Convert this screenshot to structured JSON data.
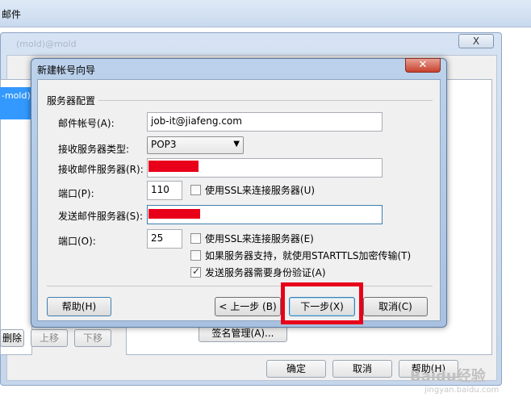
{
  "background_app": {
    "title": "邮件",
    "window_title": "(mold)@mold",
    "close_label": "X",
    "account_selected": "-mold)",
    "buttons": {
      "delete": "删除",
      "move_up": "上移",
      "move_down": "下移",
      "signature": "签名管理(A)...",
      "ok": "确定",
      "cancel": "取消",
      "help": "帮助(H)"
    }
  },
  "dialog": {
    "title": "新建帐号向导",
    "close_icon": "close-icon",
    "group_title": "服务器配置",
    "fields": {
      "email_label": "邮件帐号(A):",
      "email_value": "job-it@jiafeng.com",
      "incoming_type_label": "接收服务器类型:",
      "incoming_type_value": "POP3",
      "incoming_server_label": "接收邮件服务器(R):",
      "incoming_port_label": "端口(P):",
      "incoming_port_value": "110",
      "incoming_ssl_label": "使用SSL来连接服务器(U)",
      "outgoing_server_label": "发送邮件服务器(S):",
      "outgoing_port_label": "端口(O):",
      "outgoing_port_value": "25",
      "outgoing_ssl_label": "使用SSL来连接服务器(E)",
      "starttls_label": "如果服务器支持，就使用STARTTLS加密传输(T)",
      "auth_label": "发送服务器需要身份验证(A)"
    },
    "checkboxes": {
      "incoming_ssl": false,
      "outgoing_ssl": false,
      "starttls": false,
      "auth": true
    },
    "buttons": {
      "help": "帮助(H)",
      "back": "< 上一步 (B)",
      "next": "下一步(X)",
      "cancel": "取消(C)"
    }
  },
  "colors": {
    "highlight": "#e8001a",
    "redaction": "#e8001a"
  },
  "watermark": {
    "text": "Baidu经验",
    "sub": "jingyan.baidu.com"
  }
}
